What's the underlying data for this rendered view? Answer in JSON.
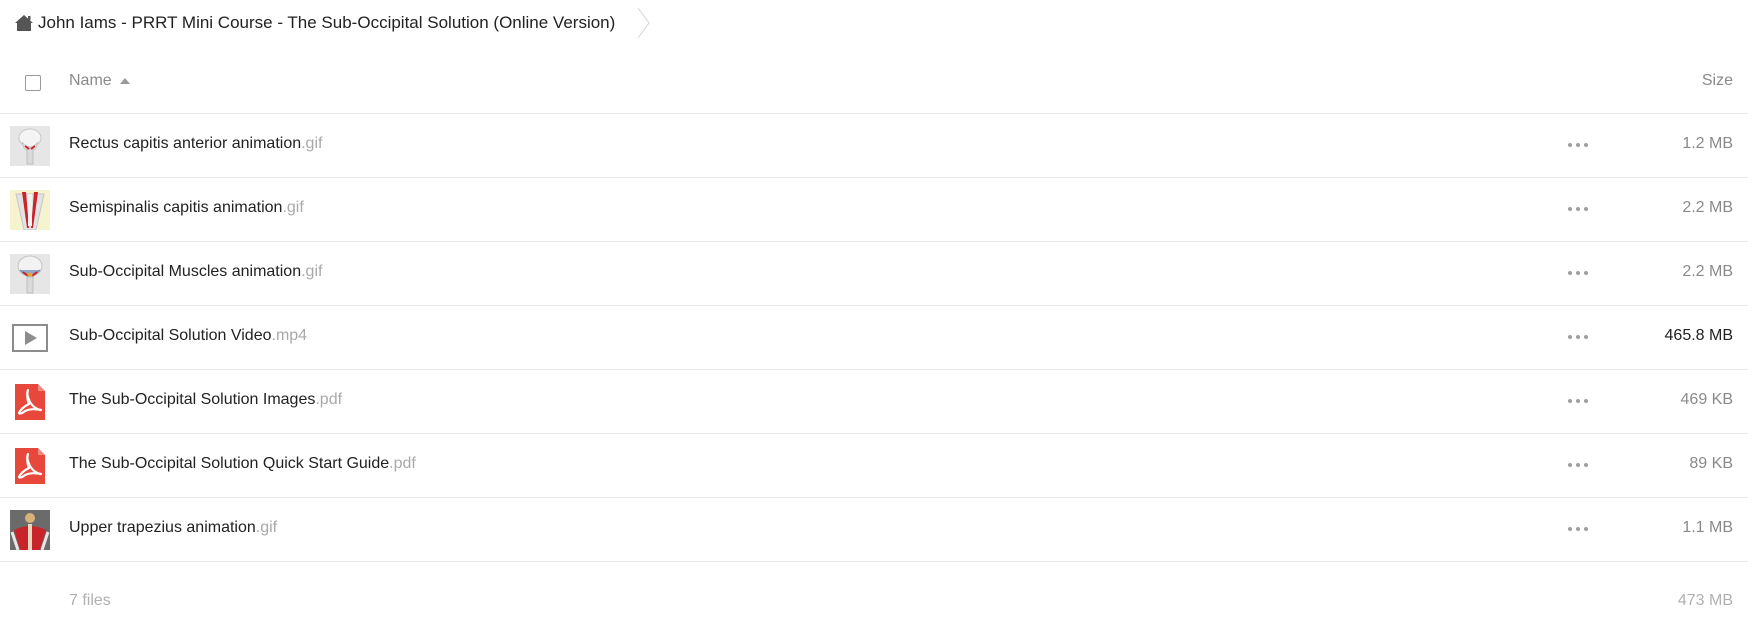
{
  "breadcrumb": {
    "home_icon": "home-icon",
    "current_folder": "John Iams - PRRT Mini Course - The Sub-Occipital Solution (Online Version)"
  },
  "table": {
    "header_name": "Name",
    "header_size": "Size",
    "sort_direction": "ascending"
  },
  "files": [
    {
      "name": "Rectus capitis anterior animation",
      "ext": ".gif",
      "size": "1.2 MB",
      "thumb": "anatomy-skull-thumbnail"
    },
    {
      "name": "Semispinalis capitis animation",
      "ext": ".gif",
      "size": "2.2 MB",
      "thumb": "anatomy-neck-muscle-thumbnail"
    },
    {
      "name": "Sub-Occipital Muscles animation",
      "ext": ".gif",
      "size": "2.2 MB",
      "thumb": "anatomy-suboccipital-thumbnail"
    },
    {
      "name": "Sub-Occipital Solution Video",
      "ext": ".mp4",
      "size": "465.8 MB",
      "thumb": "video-play-icon"
    },
    {
      "name": "The Sub-Occipital Solution Images",
      "ext": ".pdf",
      "size": "469 KB",
      "thumb": "pdf-icon"
    },
    {
      "name": "The Sub-Occipital Solution Quick Start Guide",
      "ext": ".pdf",
      "size": "89 KB",
      "thumb": "pdf-icon"
    },
    {
      "name": "Upper trapezius animation",
      "ext": ".gif",
      "size": "1.1 MB",
      "thumb": "anatomy-trapezius-thumbnail"
    }
  ],
  "summary": {
    "file_count": "7 files",
    "total_size": "473 MB"
  },
  "colors": {
    "pdf_red": "#e8483b",
    "muscle_red": "#c8252a",
    "divider": "#ebebeb",
    "muted_text": "#8a8a8a",
    "extension_text": "#a9a9a9"
  }
}
